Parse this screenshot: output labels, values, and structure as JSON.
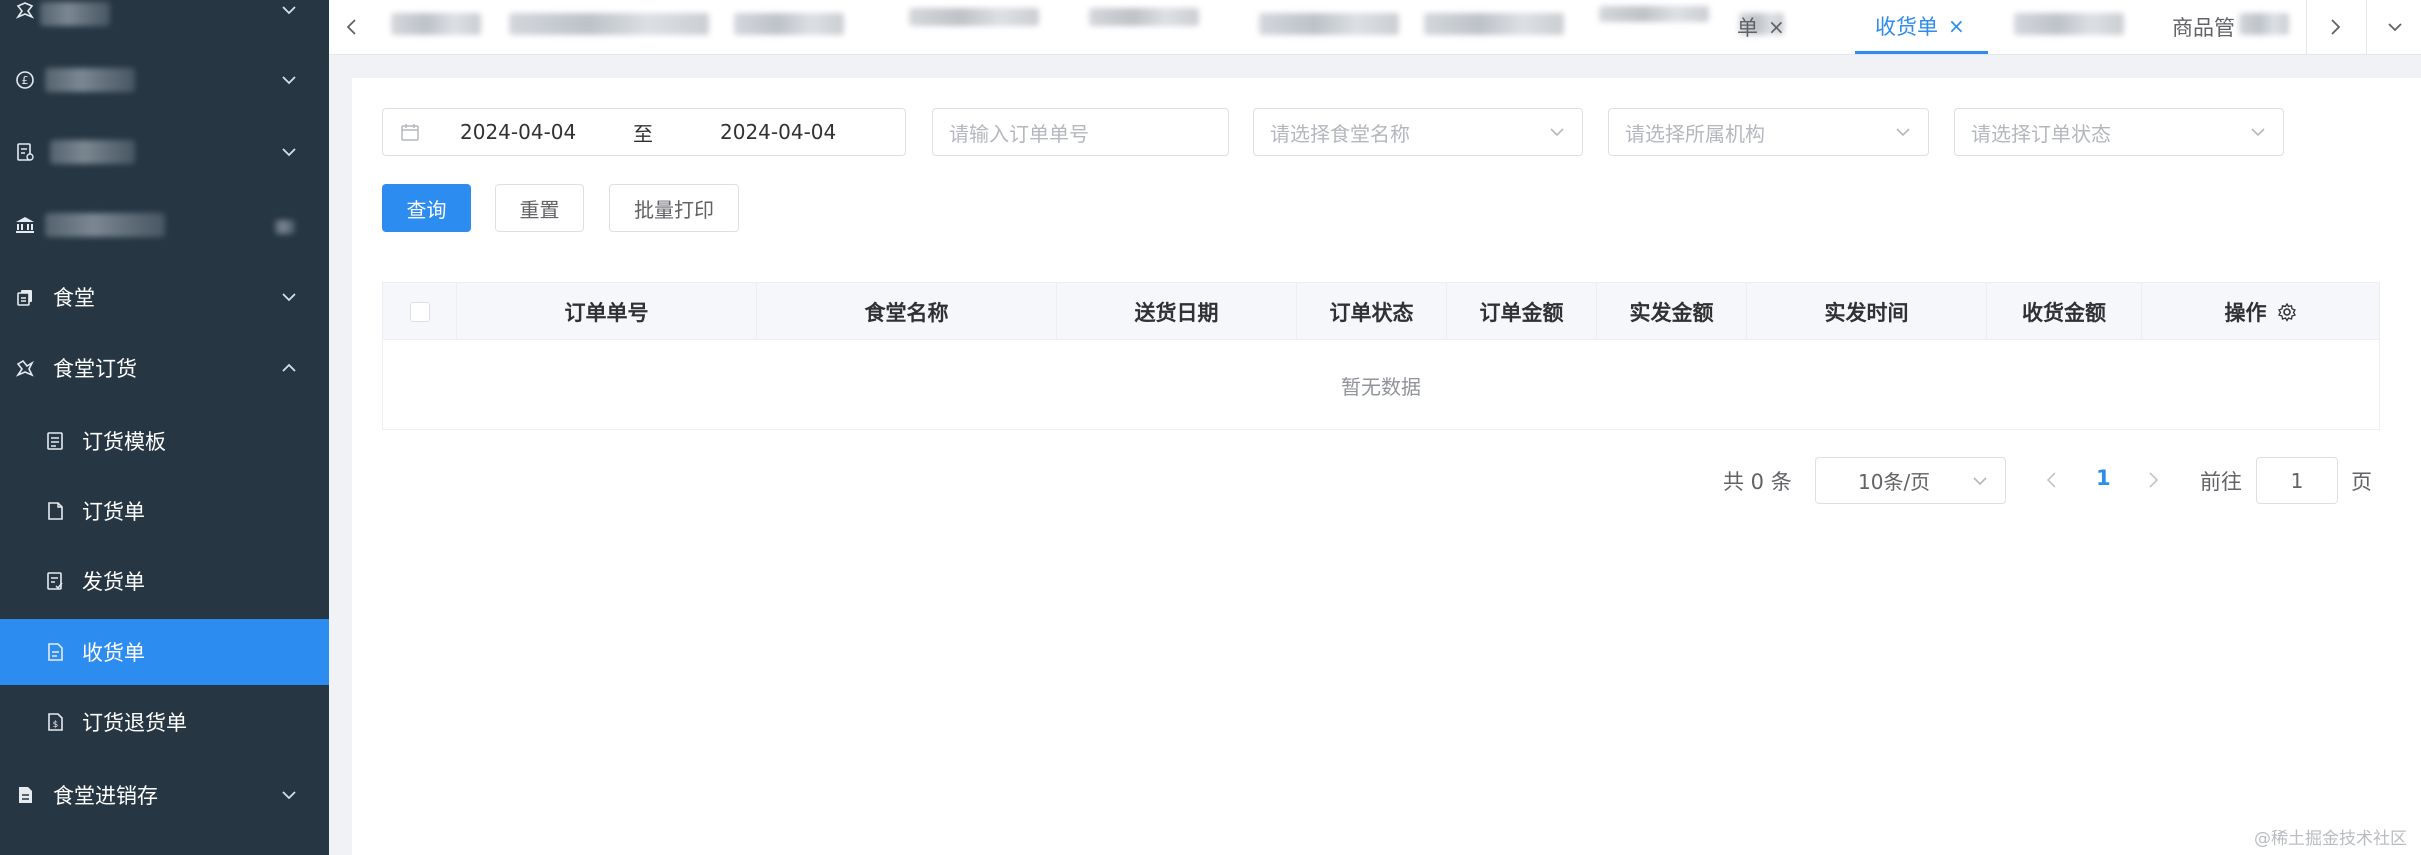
{
  "sidebar": {
    "top_items": [
      {
        "icon": "coupon-icon"
      },
      {
        "icon": "pound-icon"
      },
      {
        "icon": "report-icon"
      },
      {
        "icon": "bank-icon"
      }
    ],
    "canteen": {
      "label": "食堂",
      "icon": "copy-icon"
    },
    "ordering": {
      "label": "食堂订货",
      "icon": "coupon-icon",
      "expanded": true
    },
    "sub_items": [
      {
        "label": "订货模板",
        "icon": "document-icon"
      },
      {
        "label": "订货单",
        "icon": "page-icon"
      },
      {
        "label": "发货单",
        "icon": "checklist-icon"
      },
      {
        "label": "收货单",
        "icon": "receipt-icon",
        "active": true
      },
      {
        "label": "订货退货单",
        "icon": "return-doc-icon"
      }
    ],
    "inventory": {
      "label": "食堂进销存",
      "icon": "file-icon"
    },
    "active_color": "#2d8cf0",
    "background": "#263643"
  },
  "tabs": {
    "visible": [
      {
        "label": "单",
        "closable": true
      },
      {
        "label": "收货单",
        "closable": true,
        "active": true
      },
      {
        "label": "商品管"
      }
    ]
  },
  "filters": {
    "date_start": "2024-04-04",
    "date_separator": "至",
    "date_end": "2024-04-04",
    "order_no_placeholder": "请输入订单单号",
    "canteen_placeholder": "请选择食堂名称",
    "org_placeholder": "请选择所属机构",
    "status_placeholder": "请选择订单状态"
  },
  "actions": {
    "query": "查询",
    "reset": "重置",
    "batch_print": "批量打印"
  },
  "table": {
    "columns": [
      "订单单号",
      "食堂名称",
      "送货日期",
      "订单状态",
      "订单金额",
      "实发金额",
      "实发时间",
      "收货金额",
      "操作"
    ],
    "empty_text": "暂无数据"
  },
  "pagination": {
    "total_text": "共 0 条",
    "page_size": "10条/页",
    "current_page": "1",
    "goto_label": "前往",
    "goto_value": "1",
    "page_suffix": "页"
  },
  "watermark": "@稀土掘金技术社区"
}
